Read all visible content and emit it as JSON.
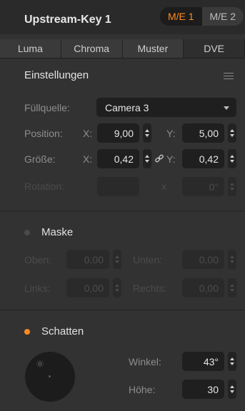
{
  "window": {
    "title": "Upstream-Key 1"
  },
  "me_buttons": [
    {
      "label": "M/E 1",
      "active": true
    },
    {
      "label": "M/E 2",
      "active": false
    }
  ],
  "tabs": [
    {
      "label": "Luma",
      "active": false
    },
    {
      "label": "Chroma",
      "active": false
    },
    {
      "label": "Muster",
      "active": false
    },
    {
      "label": "DVE",
      "active": true
    }
  ],
  "settings": {
    "heading": "Einstellungen",
    "fill_source": {
      "label": "Füllquelle:",
      "value": "Camera 3"
    },
    "position": {
      "label": "Position:",
      "x_label": "X:",
      "x_value": "9,00",
      "y_label": "Y:",
      "y_value": "5,00"
    },
    "size": {
      "label": "Größe:",
      "x_label": "X:",
      "x_value": "0,42",
      "y_label": "Y:",
      "y_value": "0,42"
    },
    "rotation": {
      "label": "Rotation:",
      "x_label": "x",
      "value": "0°"
    }
  },
  "mask": {
    "heading": "Maske",
    "enabled": false,
    "top": {
      "label": "Oben:",
      "value": "0,00"
    },
    "bottom": {
      "label": "Unten:",
      "value": "0,00"
    },
    "left": {
      "label": "Links:",
      "value": "0,00"
    },
    "right": {
      "label": "Rechts:",
      "value": "0,00"
    }
  },
  "shadow": {
    "heading": "Schatten",
    "enabled": true,
    "angle": {
      "label": "Winkel:",
      "value": "43°"
    },
    "height": {
      "label": "Höhe:",
      "value": "30"
    }
  },
  "colors": {
    "accent": "#ff8a20",
    "panel": "#323232",
    "field": "#1f1f1f"
  }
}
